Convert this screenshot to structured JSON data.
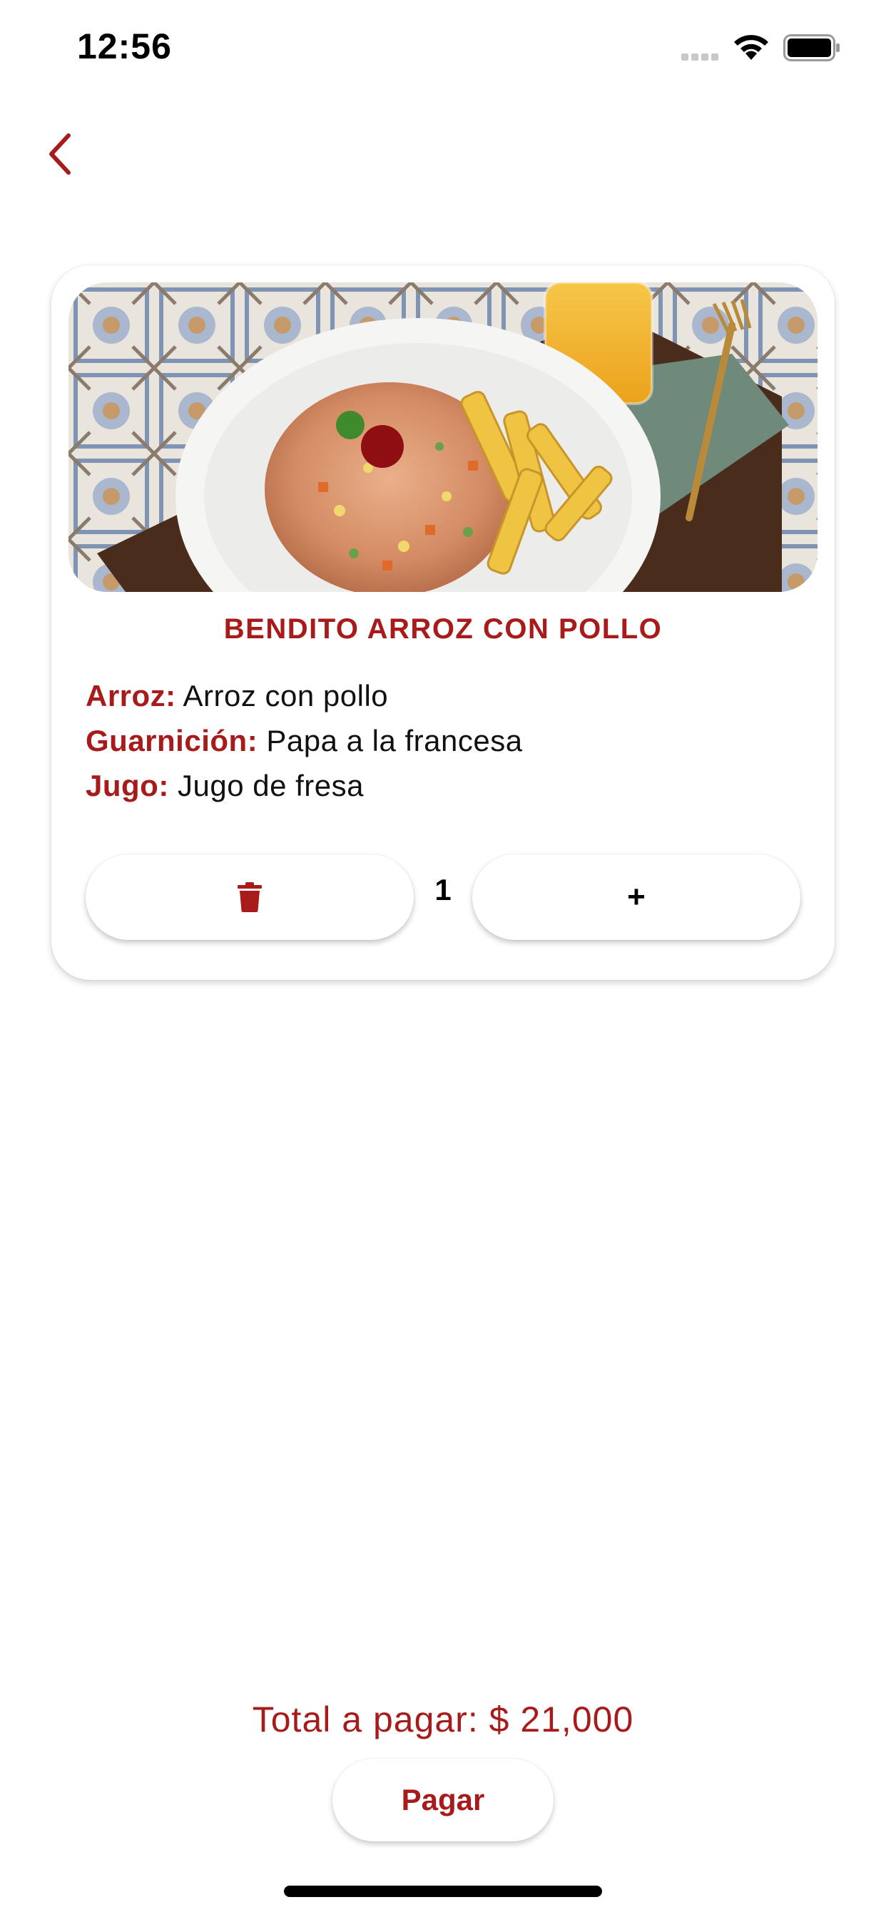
{
  "status_bar": {
    "time": "12:56",
    "icons": [
      "signal-icon",
      "wifi-icon",
      "battery-icon"
    ]
  },
  "nav": {
    "back_icon": "chevron-left-icon",
    "accent_color": "#a81b1b"
  },
  "item": {
    "image_icon": "food-photo",
    "title": "BENDITO ARROZ CON POLLO",
    "details": [
      {
        "label": "Arroz:",
        "value": "Arroz con pollo"
      },
      {
        "label": "Guarnición:",
        "value": "Papa a la francesa"
      },
      {
        "label": "Jugo:",
        "value": "Jugo de fresa"
      }
    ],
    "quantity": "1",
    "delete_icon": "trash-icon",
    "add_label": "+"
  },
  "footer": {
    "total_text": "Total a pagar: $ 21,000",
    "pay_label": "Pagar"
  }
}
